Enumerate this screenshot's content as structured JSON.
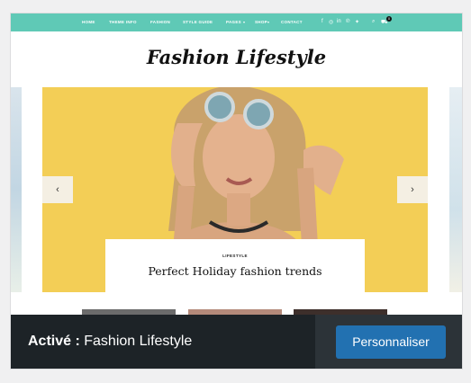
{
  "theme_nav": {
    "items": [
      "HOME",
      "THEME INFO",
      "FASHION",
      "STYLE GUIDE",
      "PAGES",
      "SHOP",
      "CONTACT"
    ],
    "cart_count": "0"
  },
  "theme_logo": "Fashion Lifestyle",
  "slider": {
    "prev_icon": "‹",
    "next_icon": "›",
    "caption_tag": "LIFESTYLE",
    "caption_title": "Perfect Holiday fashion trends"
  },
  "footer": {
    "status_label": "Activé :",
    "theme_name": "Fashion Lifestyle",
    "customize_label": "Personnaliser"
  },
  "colors": {
    "nav": "#5fc9b6",
    "footer": "#1d2327",
    "button": "#2271b1",
    "hero_bg": "#f2c94c"
  }
}
